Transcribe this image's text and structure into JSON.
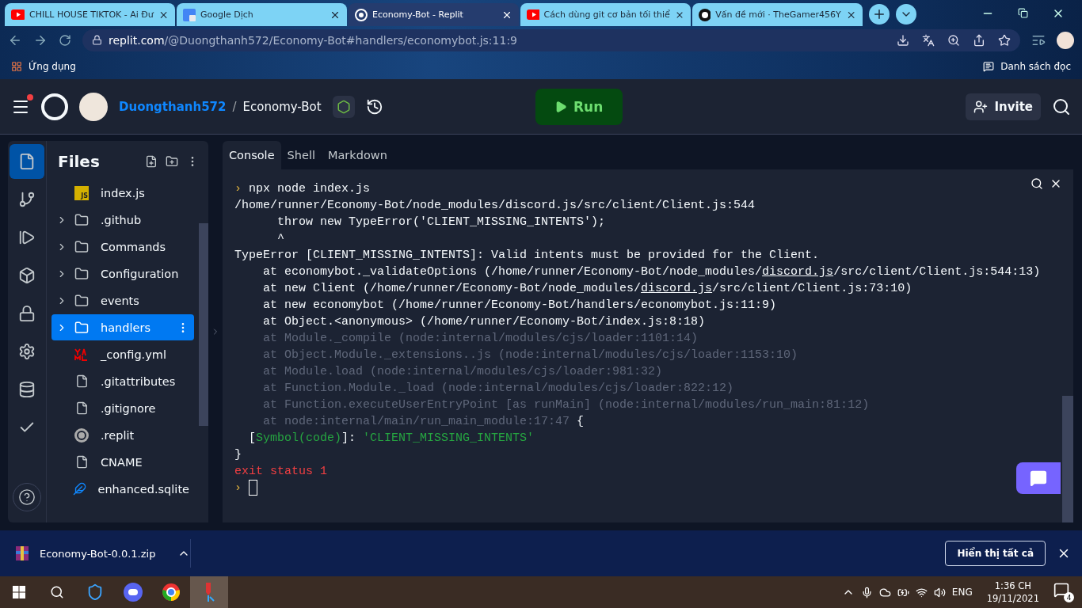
{
  "browser": {
    "tabs": [
      {
        "title": "CHILL HOUSE TIKTOK - Ai Đư",
        "kind": "youtube",
        "selected": false
      },
      {
        "title": "Google Dịch",
        "kind": "translate",
        "selected": false
      },
      {
        "title": "Economy-Bot - Replit",
        "kind": "replit",
        "selected": true
      },
      {
        "title": "Cách dùng git cơ bản tối thiể",
        "kind": "youtube",
        "selected": false
      },
      {
        "title": "Vấn đề mới · TheGamer456Y",
        "kind": "github",
        "selected": false
      }
    ],
    "url": {
      "host": "replit.com",
      "path": "/@Duongthanh572/Economy-Bot#handlers/economybot.js:11:9"
    },
    "bookmarks": [
      "Ứng dụng"
    ],
    "reading_list": "Danh sách đọc"
  },
  "header": {
    "user": "Duongthanh572",
    "separator": "/",
    "project": "Economy-Bot",
    "run": "Run",
    "invite": "Invite",
    "menu_badge": true
  },
  "rail": [
    {
      "kind": "files",
      "selected": true
    },
    {
      "kind": "git",
      "selected": false
    },
    {
      "kind": "debugger",
      "selected": false
    },
    {
      "kind": "packages",
      "selected": false
    },
    {
      "kind": "secrets",
      "selected": false
    },
    {
      "kind": "settings",
      "selected": false
    },
    {
      "kind": "database",
      "selected": false
    },
    {
      "kind": "tests",
      "selected": false
    }
  ],
  "files": {
    "title": "Files",
    "items": [
      {
        "name": "index.js",
        "kind": "js",
        "badge": "JS",
        "selected": false
      },
      {
        "name": ".github",
        "kind": "folder",
        "selected": false
      },
      {
        "name": "Commands",
        "kind": "folder",
        "selected": false
      },
      {
        "name": "Configuration",
        "kind": "folder",
        "selected": false
      },
      {
        "name": "events",
        "kind": "folder",
        "selected": false
      },
      {
        "name": "handlers",
        "kind": "folder",
        "selected": true
      },
      {
        "name": "_config.yml",
        "kind": "yaml",
        "selected": false
      },
      {
        "name": ".gitattributes",
        "kind": "file",
        "selected": false
      },
      {
        "name": ".gitignore",
        "kind": "file",
        "selected": false
      },
      {
        "name": ".replit",
        "kind": "replit",
        "selected": false
      },
      {
        "name": "CNAME",
        "kind": "file",
        "selected": false
      },
      {
        "name": "enhanced.sqlite",
        "kind": "sqlite",
        "selected": false
      }
    ]
  },
  "console_tabs": [
    {
      "label": "Console",
      "selected": true
    },
    {
      "label": "Shell",
      "selected": false
    },
    {
      "label": "Markdown",
      "selected": false
    }
  ],
  "console": [
    [
      {
        "text": "› ",
        "kind": "prompt"
      },
      {
        "text": "npx node index.js",
        "kind": "plain"
      }
    ],
    [
      {
        "text": "/home/runner/Economy-Bot/node_modules/discord.js/src/client/Client.js:544",
        "kind": "plain"
      }
    ],
    [
      {
        "text": "      throw new TypeError('CLIENT_MISSING_INTENTS');",
        "kind": "plain"
      }
    ],
    [
      {
        "text": "      ^",
        "kind": "plain"
      }
    ],
    [
      {
        "text": "TypeError [CLIENT_MISSING_INTENTS]: Valid intents must be provided for the Client.",
        "kind": "plain"
      }
    ],
    [
      {
        "text": "    at economybot._validateOptions (/home/runner/Economy-Bot/node_modules/",
        "kind": "plain"
      },
      {
        "text": "discord.js",
        "kind": "link"
      },
      {
        "text": "/src/client/Client.js:544:13)",
        "kind": "plain"
      }
    ],
    [
      {
        "text": "    at new Client (/home/runner/Economy-Bot/node_modules/",
        "kind": "plain"
      },
      {
        "text": "discord.js",
        "kind": "link"
      },
      {
        "text": "/src/client/Client.js:73:10)",
        "kind": "plain"
      }
    ],
    [
      {
        "text": "    at new economybot (/home/runner/Economy-Bot/handlers/economybot.js:11:9)",
        "kind": "plain"
      }
    ],
    [
      {
        "text": "    at Object.<anonymous> (/home/runner/Economy-Bot/index.js:8:18)",
        "kind": "plain"
      }
    ],
    [
      {
        "text": "    at Module._compile (node:internal/modules/cjs/loader:1101:14)",
        "kind": "dim"
      }
    ],
    [
      {
        "text": "    at Object.Module._extensions..js (node:internal/modules/cjs/loader:1153:10)",
        "kind": "dim"
      }
    ],
    [
      {
        "text": "    at Module.load (node:internal/modules/cjs/loader:981:32)",
        "kind": "dim"
      }
    ],
    [
      {
        "text": "    at Function.Module._load (node:internal/modules/cjs/loader:822:12)",
        "kind": "dim"
      }
    ],
    [
      {
        "text": "    at Function.executeUserEntryPoint [as runMain] (node:internal/modules/run_main:81:12)",
        "kind": "dim"
      }
    ],
    [
      {
        "text": "    at node:internal/main/run_main_module:17:47 ",
        "kind": "dim"
      },
      {
        "text": "{",
        "kind": "plain"
      }
    ],
    [
      {
        "text": "  [",
        "kind": "plain"
      },
      {
        "text": "Symbol(code)",
        "kind": "symbol"
      },
      {
        "text": "]: ",
        "kind": "plain"
      },
      {
        "text": "'CLIENT_MISSING_INTENTS'",
        "kind": "symbol"
      }
    ],
    [
      {
        "text": "}",
        "kind": "plain"
      }
    ],
    [
      {
        "text": "exit status 1",
        "kind": "error"
      }
    ],
    [
      {
        "text": "› ",
        "kind": "prompt"
      }
    ]
  ],
  "download": {
    "file": "Economy-Bot-0.0.1.zip",
    "show_all": "Hiển thị tất cả"
  },
  "taskbar": {
    "apps": [
      {
        "kind": "shield",
        "selected": false
      },
      {
        "kind": "discord",
        "selected": false
      },
      {
        "kind": "chrome",
        "selected": false
      },
      {
        "kind": "git",
        "selected": true
      }
    ],
    "language": "ENG",
    "time": "1:36 CH",
    "date": "19/11/2021",
    "notifications": "4"
  }
}
